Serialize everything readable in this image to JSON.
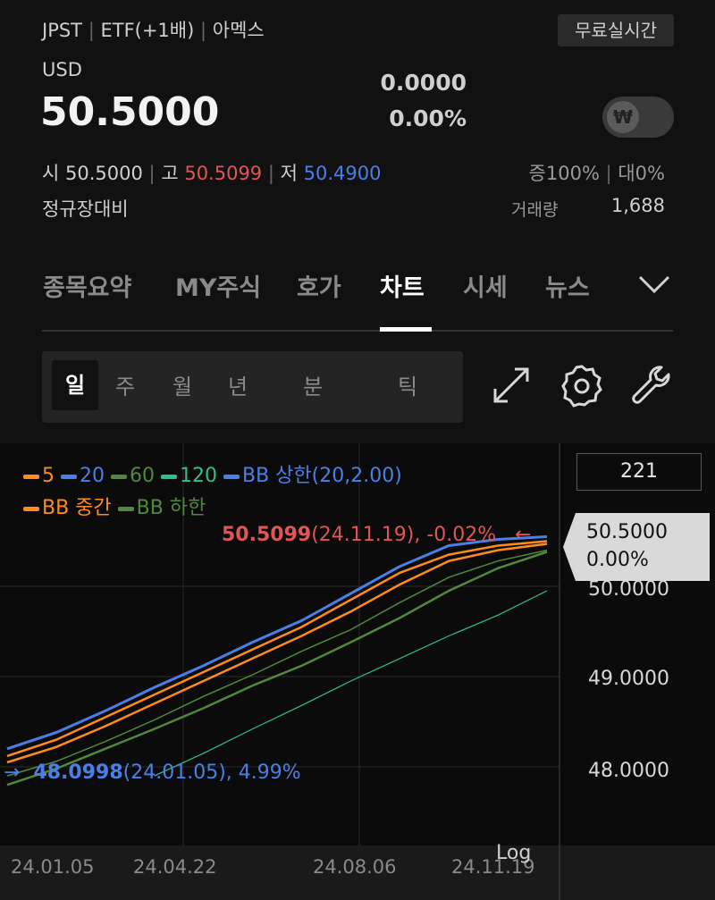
{
  "header": {
    "ticker": "JPST",
    "type": "ETF(+1배)",
    "issuer": "아멕스",
    "realtime_badge": "무료실시간",
    "currency": "USD",
    "price": "50.5000",
    "change": "0.0000",
    "change_pct": "0.00%",
    "currency_toggle_symbol": "₩"
  },
  "ohlc": {
    "open_label": "시",
    "open": "50.5000",
    "high_label": "고",
    "high": "50.5099",
    "low_label": "저",
    "low": "50.4900",
    "margin_label": "증100%",
    "loan_label": "대0%",
    "compare_label": "정규장대비",
    "volume_label": "거래량",
    "volume": "1,688"
  },
  "tabs": [
    "종목요약",
    "MY주식",
    "호가",
    "차트",
    "시세",
    "뉴스"
  ],
  "active_tab": "차트",
  "periods": [
    "일",
    "주",
    "월",
    "년",
    "분",
    "틱"
  ],
  "active_period": "일",
  "chart_count": "221",
  "colors": {
    "ma5": "#ff8c1a",
    "ma20": "#4a7fe8",
    "ma60": "#4f8a3c",
    "ma120": "#2fbf8f",
    "bb_upper": "#4a7fe8",
    "bb_mid": "#ff8c1a",
    "bb_lower": "#4f8a3c",
    "high_marker": "#e05555",
    "low_marker": "#4a7fe8"
  },
  "legend": [
    {
      "label": "5",
      "color": "#ff8c1a"
    },
    {
      "label": "20",
      "color": "#4a7fe8"
    },
    {
      "label": "60",
      "color": "#4f8a3c"
    },
    {
      "label": "120",
      "color": "#2fbf8f"
    },
    {
      "label": "BB 상한(20,2.00)",
      "color": "#4a7fe8"
    },
    {
      "label": "BB 중간",
      "color": "#ff8c1a"
    },
    {
      "label": "BB 하한",
      "color": "#4f8a3c"
    }
  ],
  "markers": {
    "high_value": "50.5099",
    "high_detail": "(24.11.19), -0.02%",
    "low_value": "48.0998",
    "low_detail": "(24.01.05), 4.99%"
  },
  "current_price_tag": {
    "price": "50.5000",
    "pct": "0.00%"
  },
  "scale_label": "Log",
  "chart_data": {
    "type": "line",
    "x_ticks": [
      "24.01.05",
      "24.04.22",
      "24.08.06",
      "24.11.19"
    ],
    "y_ticks": [
      "50.0000",
      "49.0000",
      "48.0000"
    ],
    "ylim": [
      47.7,
      50.9
    ],
    "start": {
      "date": "24.01.05",
      "value": 48.0998
    },
    "end": {
      "date": "24.11.19",
      "value": 50.5
    },
    "series": [
      {
        "name": "5",
        "values": [
          48.12,
          48.3,
          48.55,
          48.8,
          49.05,
          49.3,
          49.55,
          49.85,
          50.15,
          50.35,
          50.45,
          50.5
        ]
      },
      {
        "name": "20",
        "values": [
          48.05,
          48.22,
          48.45,
          48.7,
          48.95,
          49.2,
          49.45,
          49.72,
          50.02,
          50.28,
          50.4,
          50.47
        ]
      },
      {
        "name": "60",
        "values": [
          47.8,
          47.98,
          48.2,
          48.42,
          48.65,
          48.9,
          49.12,
          49.38,
          49.65,
          49.95,
          50.2,
          50.38
        ]
      },
      {
        "name": "120",
        "values": [
          null,
          null,
          null,
          47.9,
          48.15,
          48.42,
          48.68,
          48.95,
          49.2,
          49.45,
          49.68,
          49.95
        ]
      },
      {
        "name": "BB 상한(20,2.00)",
        "values": [
          48.2,
          48.38,
          48.62,
          48.88,
          49.12,
          49.38,
          49.62,
          49.92,
          50.22,
          50.45,
          50.52,
          50.55
        ]
      },
      {
        "name": "BB 중간",
        "values": [
          48.05,
          48.22,
          48.45,
          48.7,
          48.95,
          49.2,
          49.45,
          49.72,
          50.02,
          50.28,
          50.4,
          50.47
        ]
      },
      {
        "name": "BB 하한",
        "values": [
          47.9,
          48.06,
          48.28,
          48.52,
          48.78,
          49.02,
          49.28,
          49.52,
          49.82,
          50.1,
          50.28,
          50.4
        ]
      }
    ]
  }
}
